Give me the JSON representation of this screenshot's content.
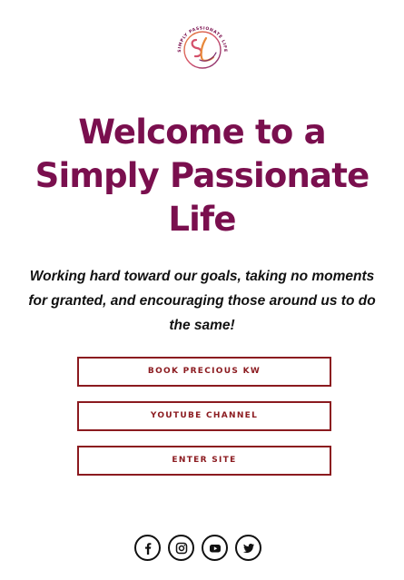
{
  "brand": {
    "logo_text": "SIMPLY PASSIONATE LIFE",
    "logo_monogram": "SL",
    "colors": {
      "headline": "#7a0f4e",
      "button_border": "#8b1a1f",
      "logo_accent_1": "#d4506b",
      "logo_accent_2": "#e8883a"
    }
  },
  "hero": {
    "headline_line_1": "Welcome to a",
    "headline_line_2": "Simply Passionate",
    "headline_line_3": "Life",
    "tagline_line_1": "Working hard toward our goals, taking no moments",
    "tagline_line_2": "for granted, and encouraging those around us to do",
    "tagline_line_3": "the same!"
  },
  "buttons": [
    {
      "label": "BOOK PRECIOUS KW"
    },
    {
      "label": "YOUTUBE CHANNEL"
    },
    {
      "label": "ENTER SITE"
    }
  ],
  "social": [
    {
      "icon": "facebook-icon"
    },
    {
      "icon": "instagram-icon"
    },
    {
      "icon": "youtube-icon"
    },
    {
      "icon": "twitter-icon"
    }
  ]
}
